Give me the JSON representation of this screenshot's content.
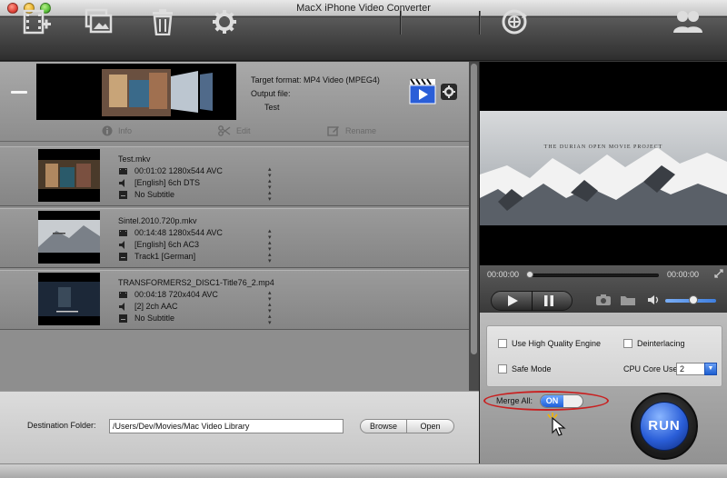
{
  "window": {
    "title": "MacX iPhone Video Converter"
  },
  "toolbar": {
    "icons": [
      "add-video-icon",
      "add-photo-icon",
      "trash-icon",
      "gear-icon",
      "update-icon",
      "users-icon"
    ]
  },
  "selected": {
    "target_format_label": "Target format: MP4 Video (MPEG4)",
    "output_file_label": "Output file:",
    "output_name": "Test",
    "actions": {
      "info": "Info",
      "edit": "Edit",
      "rename": "Rename"
    }
  },
  "videos": [
    {
      "name": "Test.mkv",
      "duration_res": "00:01:02 1280x544 AVC",
      "audio": "[English] 6ch DTS",
      "subtitle": "No Subtitle"
    },
    {
      "name": "Sintel.2010.720p.mkv",
      "duration_res": "00:14:48 1280x544 AVC",
      "audio": "[English] 6ch AC3",
      "subtitle": "Track1 [German]"
    },
    {
      "name": "TRANSFORMERS2_DISC1-Title76_2.mp4",
      "duration_res": "00:04:18 720x404 AVC",
      "audio": "[2] 2ch AAC",
      "subtitle": "No Subtitle"
    }
  ],
  "destination": {
    "label": "Destination Folder:",
    "path": "/Users/Dev/Movies/Mac Video Library",
    "browse": "Browse",
    "open": "Open"
  },
  "player": {
    "current_time": "00:00:00",
    "total_time": "00:00:00",
    "preview_caption": "THE DURIAN OPEN MOVIE PROJECT",
    "volume": 0.55
  },
  "settings": {
    "high_quality": "Use High Quality Engine",
    "deinterlacing": "Deinterlacing",
    "safe_mode": "Safe Mode",
    "cpu_label": "CPU Core Use:",
    "cpu_value": "2"
  },
  "merge": {
    "label": "Merge All:",
    "state": "ON"
  },
  "run": {
    "label": "RUN"
  },
  "colors": {
    "accent": "#2a5ed8",
    "highlight": "#c92020"
  }
}
